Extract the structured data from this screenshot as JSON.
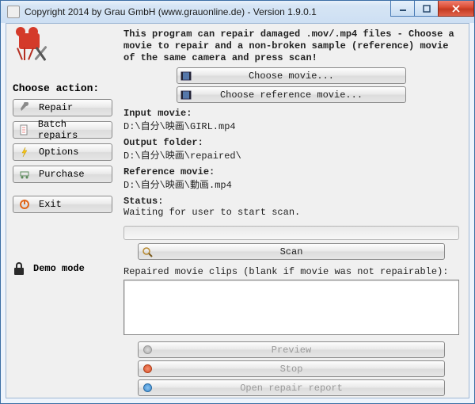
{
  "window": {
    "title": "Copyright 2014 by Grau GmbH (www.grauonline.de) - Version 1.9.0.1"
  },
  "sidebar": {
    "heading": "Choose action:",
    "buttons": {
      "repair": "Repair",
      "batch": "Batch repairs",
      "options": "Options",
      "purchase": "Purchase",
      "exit": "Exit"
    },
    "demo_mode": "Demo mode"
  },
  "main": {
    "intro": "This program can repair damaged .mov/.mp4 files - Choose a movie to repair and a non-broken sample (reference) movie of the same camera and press scan!",
    "choose_movie": "Choose movie...",
    "choose_ref": "Choose reference movie...",
    "input_label": "Input movie:",
    "input_value": "D:\\自分\\映画\\GIRL.mp4",
    "output_label": "Output folder:",
    "output_value": "D:\\自分\\映画\\repaired\\",
    "ref_label": "Reference movie:",
    "ref_value": "D:\\自分\\映画\\動画.mp4",
    "status_label": "Status:",
    "status_value": "Waiting for user to start scan.",
    "scan": "Scan",
    "repaired_label": "Repaired movie clips (blank if movie was not repairable):",
    "preview": "Preview",
    "stop": "Stop",
    "open_report": "Open repair report"
  }
}
